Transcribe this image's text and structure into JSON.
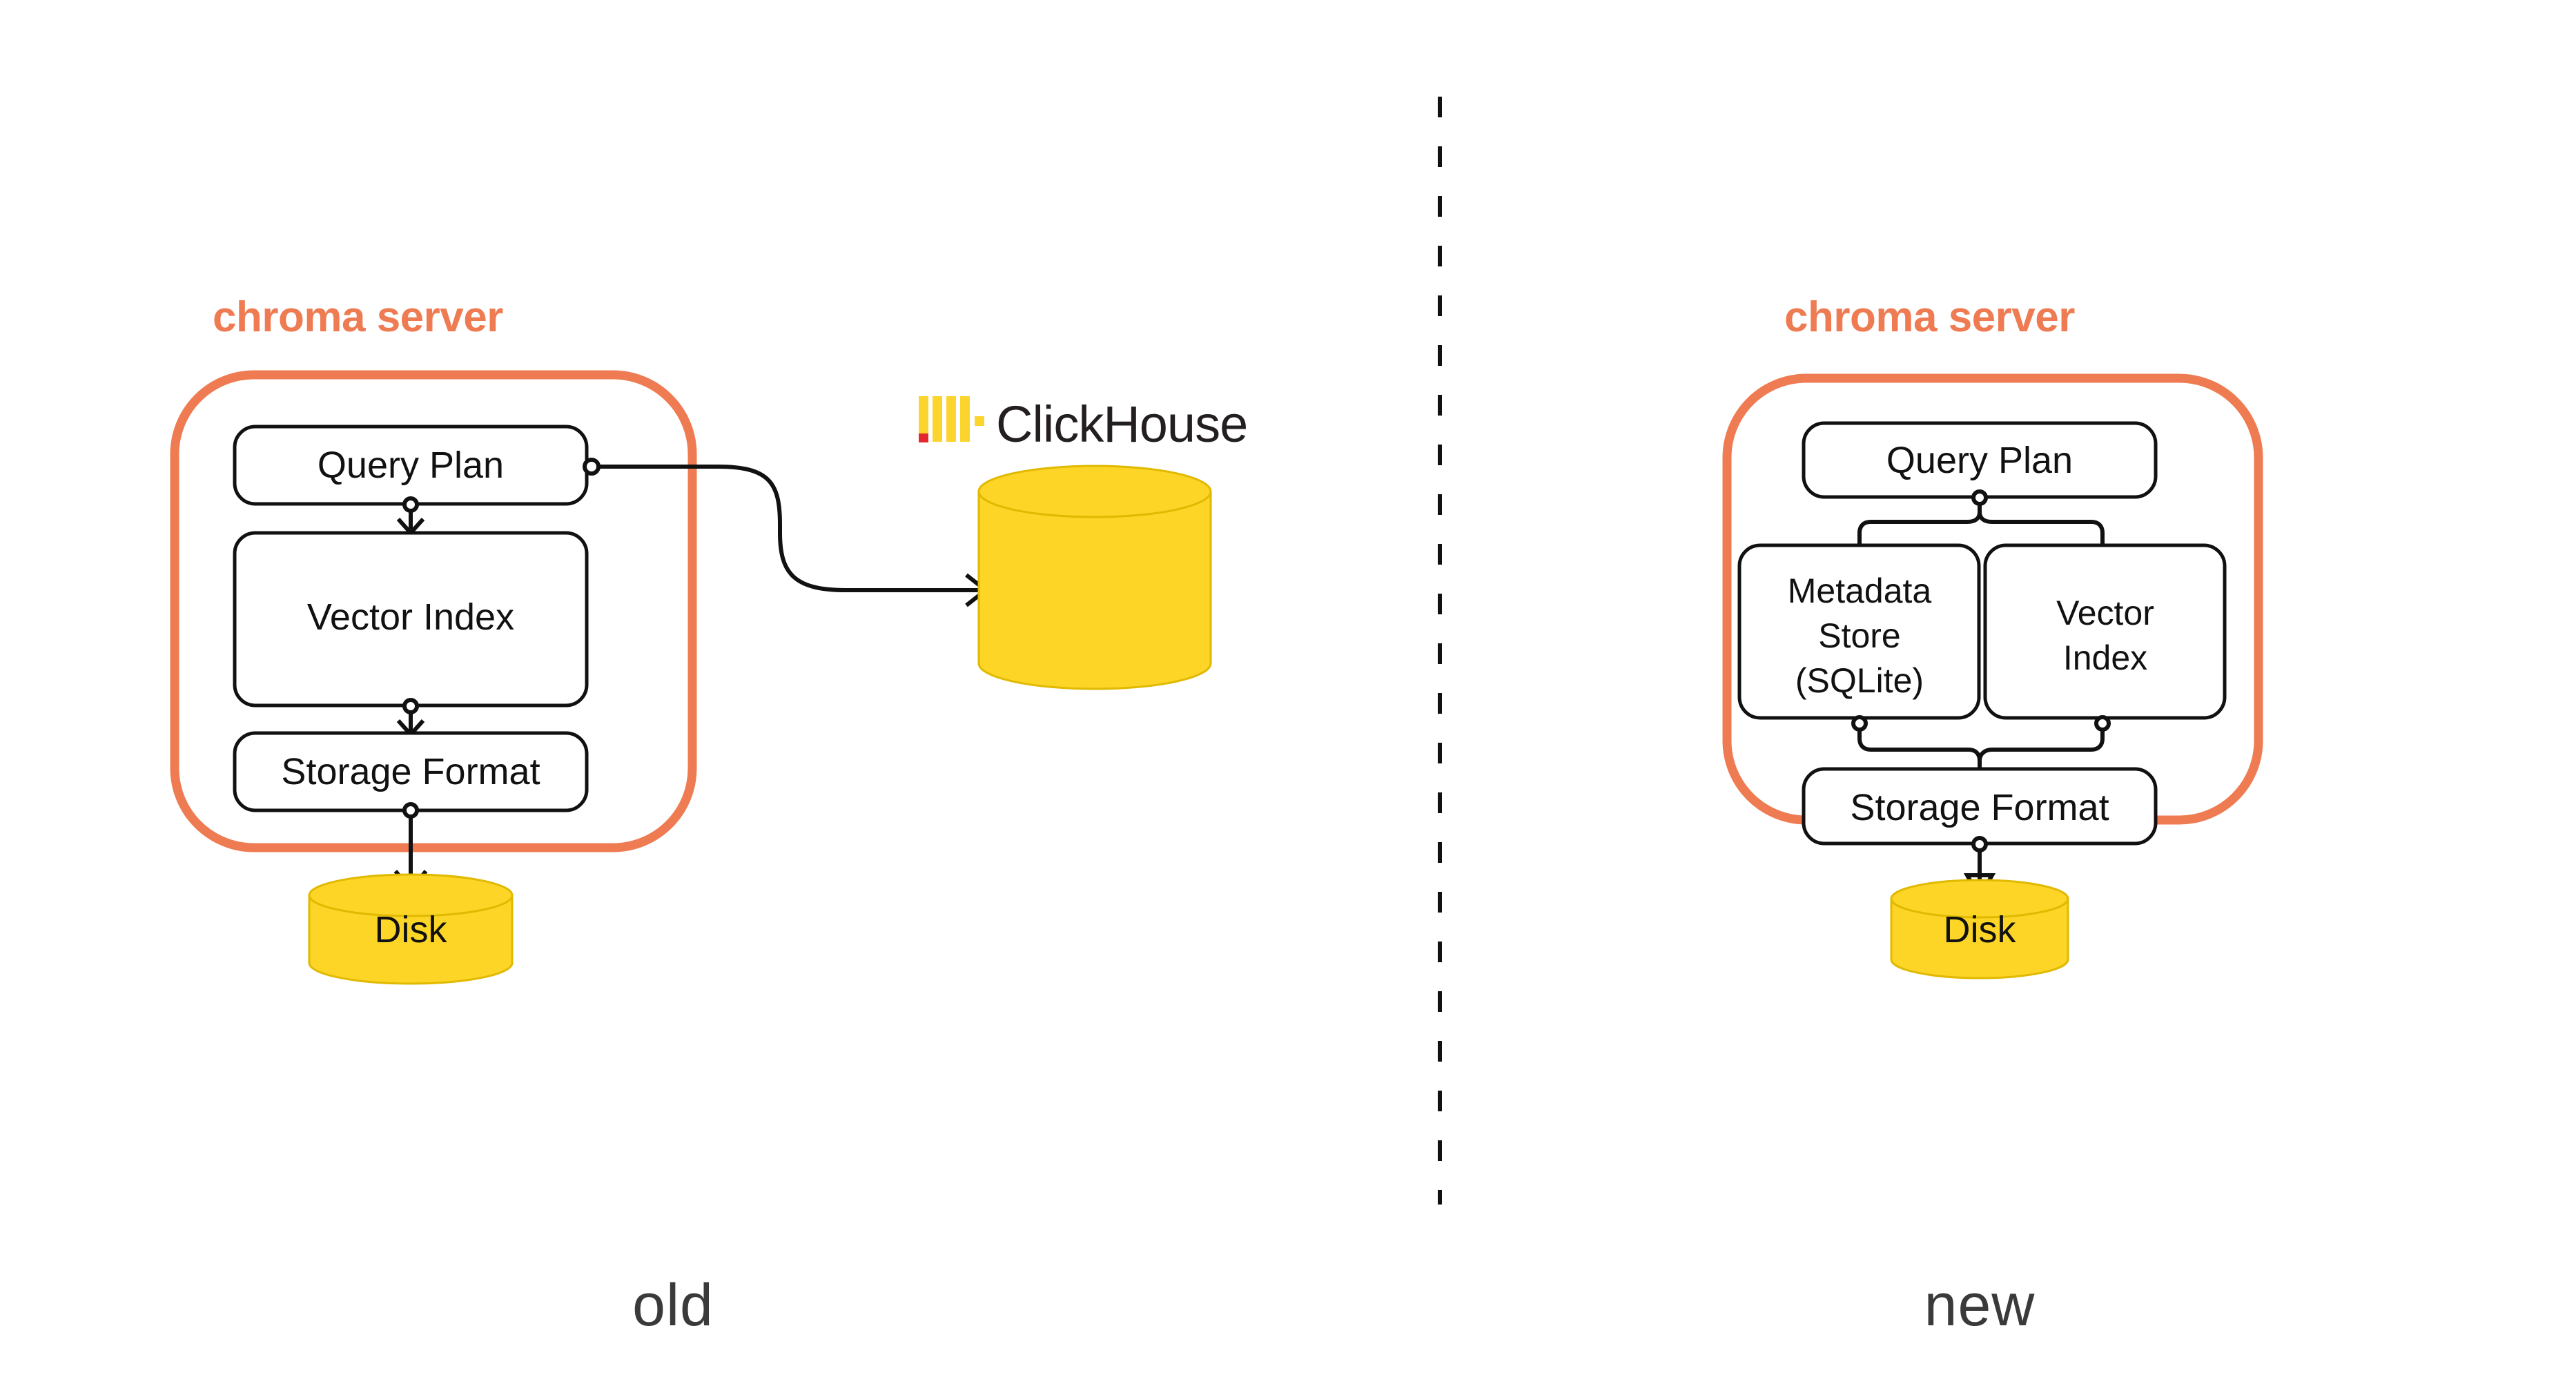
{
  "colors": {
    "chroma_orange": "#ef7b52",
    "disk_yellow": "#fcd526",
    "clickhouse_yellow": "#fbd42d",
    "clickhouse_red": "#e3272e",
    "clickhouse_text": "#231f20",
    "line_black": "#111111",
    "caption_gray": "#3a3a3a",
    "background": "#ffffff"
  },
  "panels": [
    {
      "id": "old",
      "caption": "old",
      "group_title": "chroma server",
      "boxes": [
        {
          "name": "query-plan",
          "label": "Query Plan"
        },
        {
          "name": "vector-index",
          "label": "Vector Index"
        },
        {
          "name": "storage-format",
          "label": "Storage Format"
        }
      ],
      "storage": {
        "name": "disk",
        "label": "Disk"
      },
      "external": {
        "name": "clickhouse",
        "label": "ClickHouse",
        "logo_icon": "clickhouse-bars-icon",
        "database_icon": "database-cylinder-icon"
      }
    },
    {
      "id": "new",
      "caption": "new",
      "group_title": "chroma server",
      "boxes": [
        {
          "name": "query-plan",
          "label": "Query Plan"
        },
        {
          "name": "metadata-store",
          "label": "Metadata\nStore\n(SQLite)",
          "lines": [
            "Metadata",
            "Store",
            "(SQLite)"
          ]
        },
        {
          "name": "vector-index",
          "label": "Vector\nIndex",
          "lines": [
            "Vector",
            "Index"
          ]
        },
        {
          "name": "storage-format",
          "label": "Storage Format"
        }
      ],
      "storage": {
        "name": "disk",
        "label": "Disk"
      }
    }
  ],
  "divider": {
    "name": "panel-divider",
    "style": "dashed-vertical"
  }
}
